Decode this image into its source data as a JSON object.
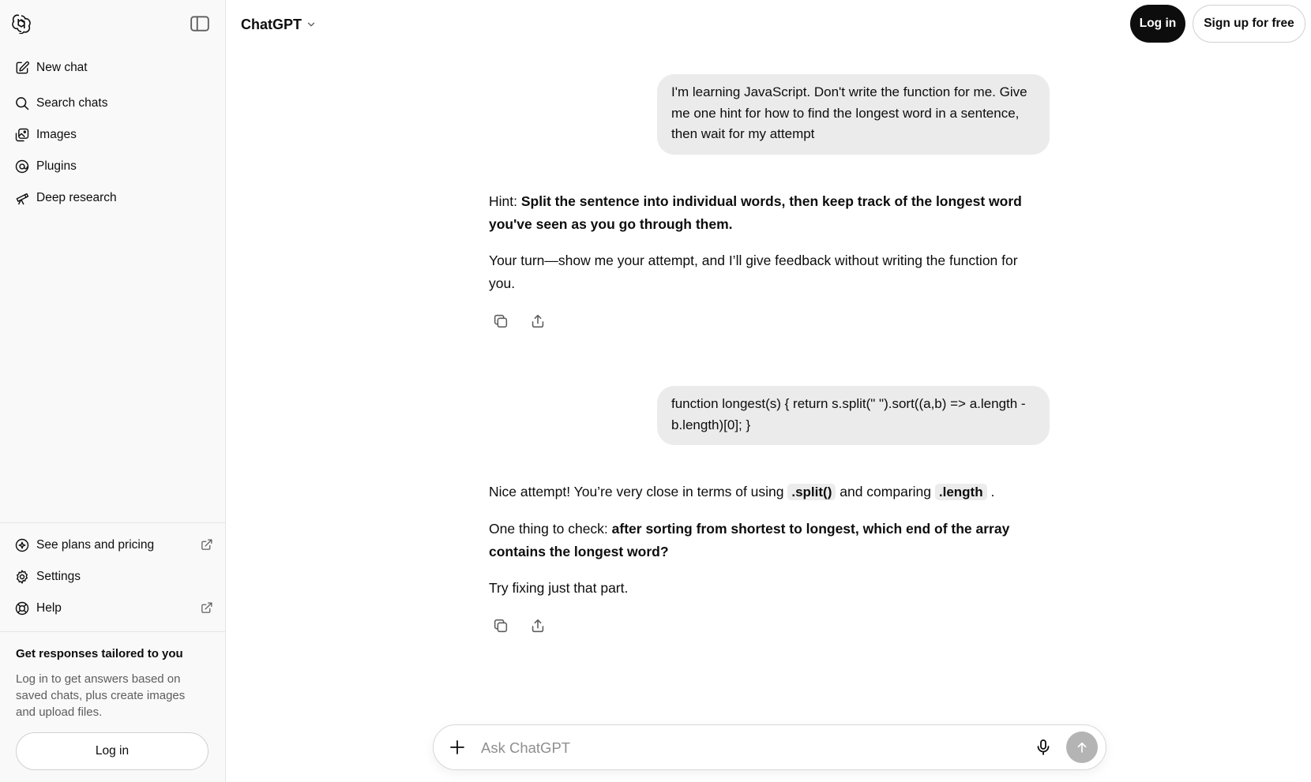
{
  "header": {
    "model_label": "ChatGPT",
    "login_label": "Log in",
    "signup_label": "Sign up for free"
  },
  "sidebar": {
    "items": [
      {
        "label": "New chat",
        "icon": "edit-icon"
      },
      {
        "label": "Search chats",
        "icon": "search-icon"
      },
      {
        "label": "Images",
        "icon": "images-icon"
      },
      {
        "label": "Plugins",
        "icon": "plugins-icon"
      },
      {
        "label": "Deep research",
        "icon": "telescope-icon"
      }
    ],
    "bottom_items": [
      {
        "label": "See plans and pricing",
        "icon": "plans-icon",
        "external": true
      },
      {
        "label": "Settings",
        "icon": "gear-icon",
        "external": false
      },
      {
        "label": "Help",
        "icon": "help-icon",
        "external": true
      }
    ],
    "cta": {
      "title": "Get responses tailored to you",
      "text": "Log in to get answers based on saved chats, plus create images and upload files.",
      "login_label": "Log in"
    }
  },
  "conversation": {
    "user_1": "I'm learning JavaScript. Don't write the function for me. Give me one hint for how to find the longest word in a sentence, then wait for my attempt",
    "assistant_1": {
      "hint_prefix": "Hint: ",
      "hint_bold": "Split the sentence into individual words, then keep track of the longest word you've seen as you go through them.",
      "p2": "Your turn—show me your attempt, and I’ll give feedback without writing the function for you."
    },
    "user_2": "function longest(s) { return s.split(\" \").sort((a,b) => a.length - b.length)[0]; }",
    "assistant_2": {
      "p1_a": "Nice attempt! You’re very close in terms of using ",
      "p1_code1": ".split()",
      "p1_b": " and comparing ",
      "p1_code2": ".length",
      "p1_c": " .",
      "p2_prefix": "One thing to check: ",
      "p2_bold": "after sorting from shortest to longest, which end of the array contains the longest word?",
      "p3": "Try fixing just that part."
    }
  },
  "composer": {
    "placeholder": "Ask ChatGPT"
  },
  "colors": {
    "sidebar_bg": "#f9f9f9",
    "user_bubble": "#ebebeb",
    "primary_button": "#0d0d0d",
    "send_disabled": "#b4b4b4"
  }
}
